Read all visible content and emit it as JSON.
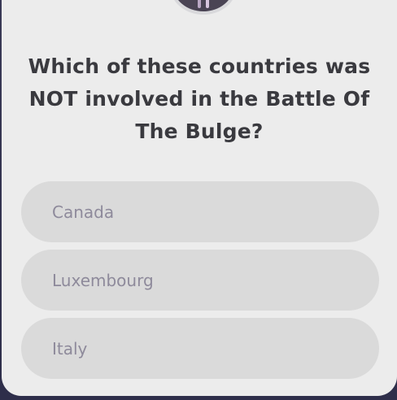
{
  "quiz": {
    "question": "Which of these countries was NOT involved in the Battle Of The Bulge?",
    "options": [
      {
        "label": "Canada"
      },
      {
        "label": "Luxembourg"
      },
      {
        "label": "Italy"
      }
    ]
  },
  "colors": {
    "background": "#2e2e4a",
    "card": "#ececec",
    "option_bg": "#dadada",
    "option_text": "#8e8a9b",
    "question_text": "#3a3a3f"
  }
}
